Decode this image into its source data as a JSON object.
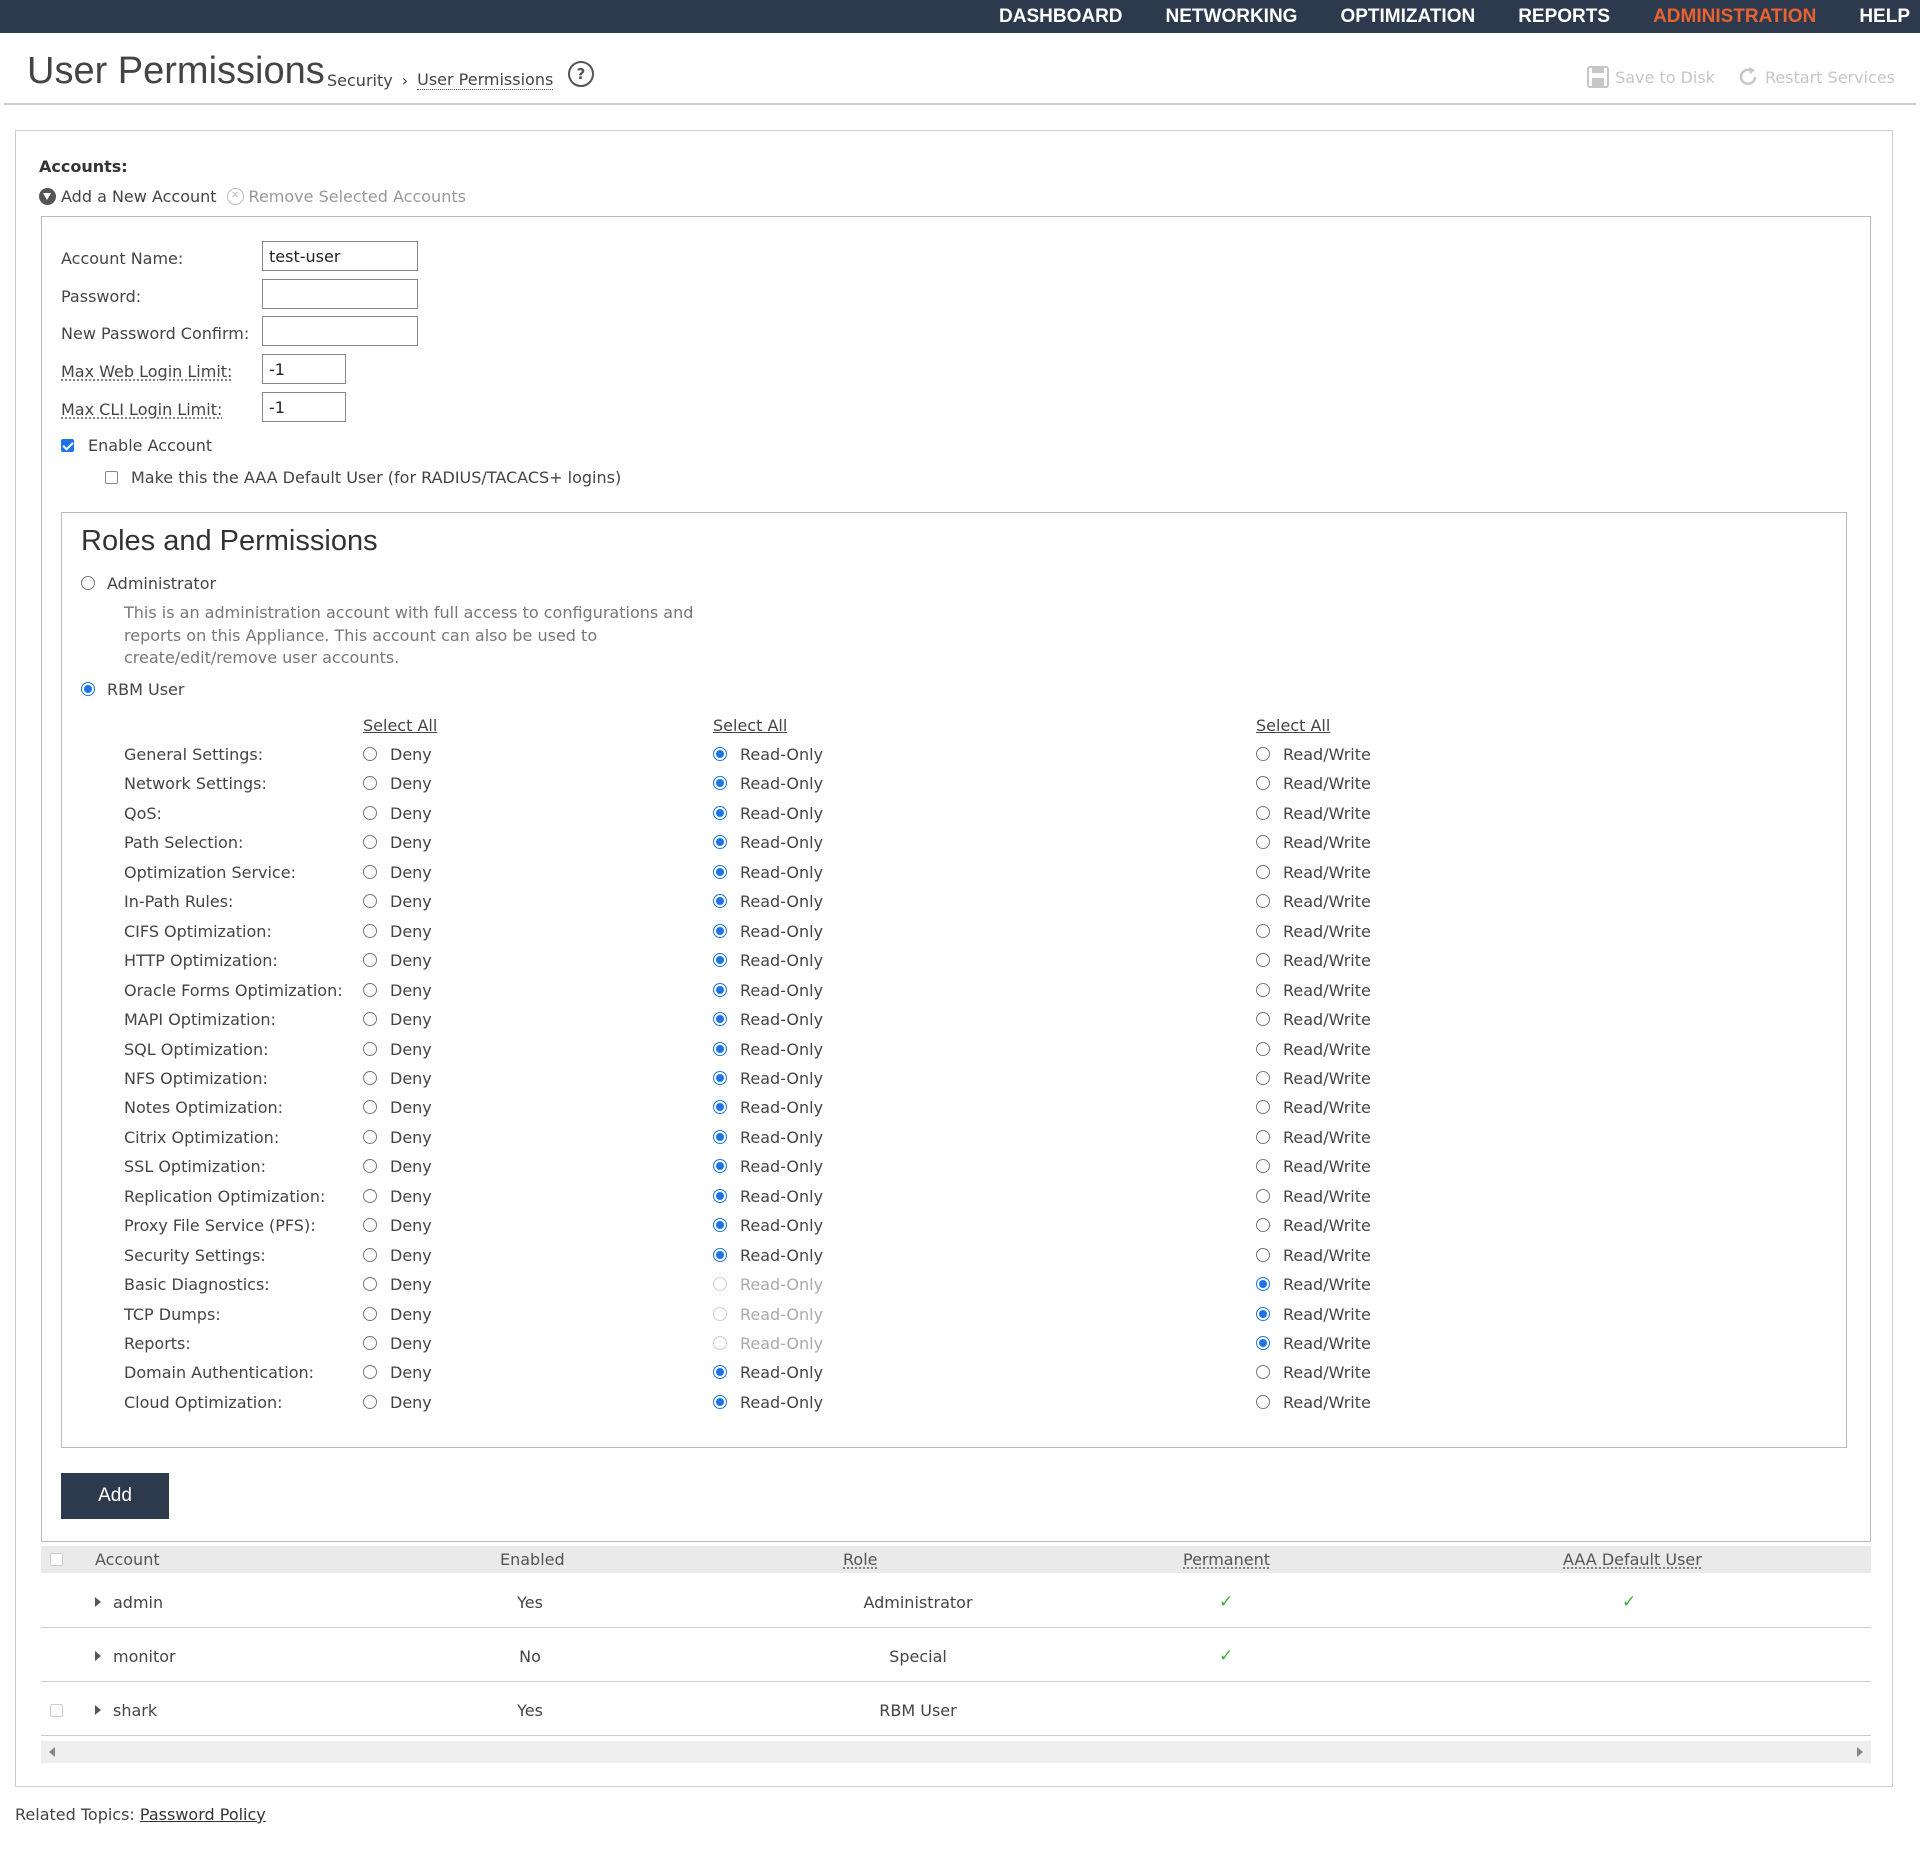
{
  "nav": {
    "items": [
      "DASHBOARD",
      "NETWORKING",
      "OPTIMIZATION",
      "REPORTS",
      "ADMINISTRATION",
      "HELP"
    ],
    "active": "ADMINISTRATION",
    "active_color": "#e8632f",
    "bar_color": "#2d3a4e"
  },
  "header": {
    "title": "User Permissions",
    "breadcrumb": [
      "Security",
      "User Permissions"
    ],
    "help_icon": "?",
    "save_label": "Save to Disk",
    "restart_label": "Restart Services"
  },
  "accounts": {
    "label": "Accounts:",
    "add_label": "Add a New Account",
    "remove_label": "Remove Selected Accounts"
  },
  "form": {
    "account_name_label": "Account Name:",
    "account_name_value": "test-user",
    "password_label": "Password:",
    "password_confirm_label": "New Password Confirm:",
    "max_web_label": "Max Web Login Limit:",
    "max_web_value": "-1",
    "max_cli_label": "Max CLI Login Limit:",
    "max_cli_value": "-1",
    "enable_label": "Enable Account",
    "enable_checked": true,
    "aaa_label": "Make this the AAA Default User (for RADIUS/TACACS+ logins)",
    "aaa_checked": false
  },
  "roles": {
    "title": "Roles and Permissions",
    "admin_label": "Administrator",
    "admin_desc": "This is an administration account with full access to configurations and reports on this Appliance. This account can also be used to create/edit/remove user accounts.",
    "rbm_label": "RBM User",
    "selected_role": "RBM User",
    "select_all_label": "Select All",
    "deny_label": "Deny",
    "ro_label": "Read-Only",
    "rw_label": "Read/Write",
    "permissions": [
      {
        "name": "General Settings:",
        "value": "Read-Only"
      },
      {
        "name": "Network Settings:",
        "value": "Read-Only"
      },
      {
        "name": "QoS:",
        "value": "Read-Only"
      },
      {
        "name": "Path Selection:",
        "value": "Read-Only"
      },
      {
        "name": "Optimization Service:",
        "value": "Read-Only"
      },
      {
        "name": "In-Path Rules:",
        "value": "Read-Only"
      },
      {
        "name": "CIFS Optimization:",
        "value": "Read-Only"
      },
      {
        "name": "HTTP Optimization:",
        "value": "Read-Only"
      },
      {
        "name": "Oracle Forms Optimization:",
        "value": "Read-Only"
      },
      {
        "name": "MAPI Optimization:",
        "value": "Read-Only"
      },
      {
        "name": "SQL Optimization:",
        "value": "Read-Only"
      },
      {
        "name": "NFS Optimization:",
        "value": "Read-Only"
      },
      {
        "name": "Notes Optimization:",
        "value": "Read-Only"
      },
      {
        "name": "Citrix Optimization:",
        "value": "Read-Only"
      },
      {
        "name": "SSL Optimization:",
        "value": "Read-Only"
      },
      {
        "name": "Replication Optimization:",
        "value": "Read-Only"
      },
      {
        "name": "Proxy File Service (PFS):",
        "value": "Read-Only"
      },
      {
        "name": "Security Settings:",
        "value": "Read-Only"
      },
      {
        "name": "Basic Diagnostics:",
        "value": "Read/Write",
        "ro_disabled": true
      },
      {
        "name": "TCP Dumps:",
        "value": "Read/Write",
        "ro_disabled": true
      },
      {
        "name": "Reports:",
        "value": "Read/Write",
        "ro_disabled": true
      },
      {
        "name": "Domain Authentication:",
        "value": "Read-Only"
      },
      {
        "name": "Cloud Optimization:",
        "value": "Read-Only"
      }
    ]
  },
  "add_button": "Add",
  "table": {
    "columns": [
      "Account",
      "Enabled",
      "Role",
      "Permanent",
      "AAA Default User"
    ],
    "rows": [
      {
        "account": "admin",
        "enabled": "Yes",
        "role": "Administrator",
        "permanent": true,
        "aaa": true,
        "selectable": false
      },
      {
        "account": "monitor",
        "enabled": "No",
        "role": "Special",
        "permanent": true,
        "aaa": false,
        "selectable": false
      },
      {
        "account": "shark",
        "enabled": "Yes",
        "role": "RBM User",
        "permanent": false,
        "aaa": false,
        "selectable": true
      }
    ],
    "check_glyph": "✓"
  },
  "related": {
    "label": "Related Topics:",
    "link": "Password Policy"
  }
}
